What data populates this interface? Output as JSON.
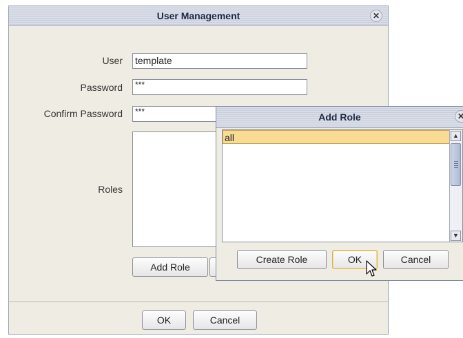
{
  "user_management": {
    "title": "User Management",
    "close_glyph": "✕",
    "fields": {
      "user_label": "User",
      "user_value": "template",
      "password_label": "Password",
      "password_value": "***",
      "confirm_label": "Confirm Password",
      "confirm_value": "***"
    },
    "roles_label": "Roles",
    "add_role_button": "Add Role",
    "ok_button": "OK",
    "cancel_button": "Cancel"
  },
  "add_role": {
    "title": "Add Role",
    "close_glyph": "✕",
    "roles": [
      "all"
    ],
    "selected_role": "all",
    "create_role_button": "Create Role",
    "ok_button": "OK",
    "cancel_button": "Cancel"
  },
  "icons": {
    "close": "close-icon",
    "scroll_up": "arrow-up-icon",
    "scroll_down": "arrow-down-icon",
    "cursor": "mouse-pointer-icon"
  },
  "colors": {
    "dialog_bg": "#efede3",
    "title_text": "#1f2a44",
    "selection": "#f8dc96"
  }
}
